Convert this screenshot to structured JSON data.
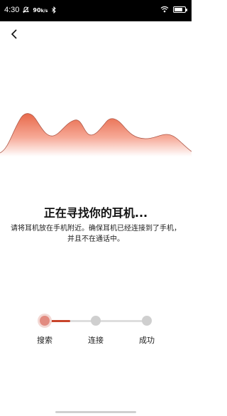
{
  "status_bar": {
    "time": "4:30",
    "network_speed": "90",
    "network_speed_unit": "k/s",
    "battery_percent": 75,
    "icons": [
      "muted-icon",
      "bluetooth-icon",
      "wifi-icon",
      "battery-icon"
    ]
  },
  "nav": {
    "back_icon": "chevron-left-icon"
  },
  "search": {
    "title": "正在寻找你的耳机...",
    "description": "请将耳机放在手机附近。确保耳机已经连接到了手机，并且不在通话中。"
  },
  "stepper": {
    "steps": [
      {
        "label": "搜索",
        "active": true
      },
      {
        "label": "连接",
        "active": false
      },
      {
        "label": "成功",
        "active": false
      }
    ],
    "accent_color": "#c8452b",
    "inactive_color": "#cfcfcf"
  },
  "colors": {
    "wave_top": "#e8694a",
    "wave_fade": "#fde6df",
    "background": "#ffffff"
  }
}
